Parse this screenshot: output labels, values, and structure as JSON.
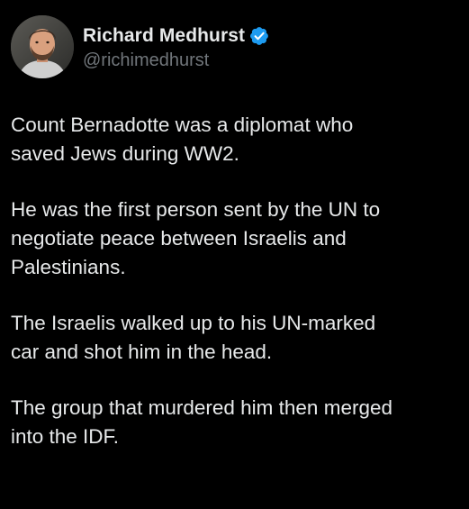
{
  "author": {
    "display_name": "Richard Medhurst",
    "handle": "@richimedhurst",
    "verified": true,
    "verified_icon": "verified-badge-icon",
    "verified_color": "#1d9bf0"
  },
  "tweet": {
    "paragraphs": [
      "Count Bernadotte was a diplomat who\nsaved Jews during WW2.",
      "He was the first person sent by the UN to\nnegotiate peace between Israelis and\nPalestinians.",
      "The Israelis walked up to his UN-marked\ncar and shot him in the head.",
      "The group that murdered him then merged\ninto the IDF."
    ]
  },
  "theme": {
    "background": "#000000",
    "text": "#e7e9ea",
    "secondary_text": "#71767b"
  }
}
